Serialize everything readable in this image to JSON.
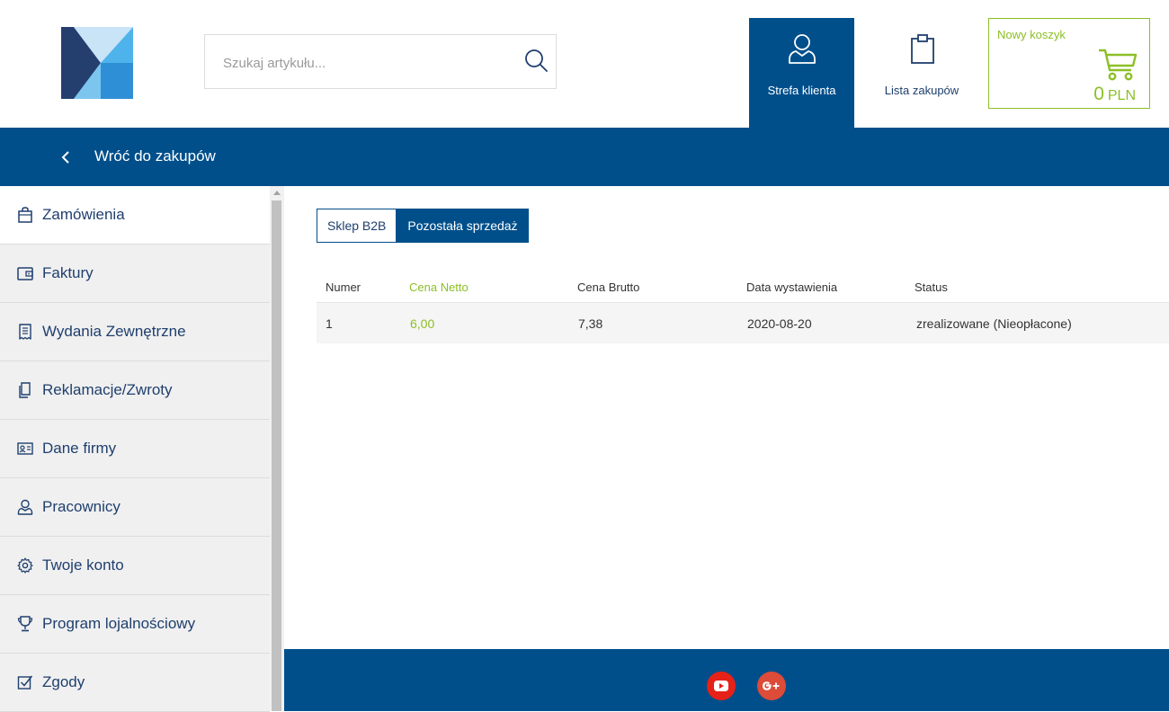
{
  "header": {
    "search": {
      "placeholder": "Szukaj artykułu..."
    },
    "nav": {
      "account_label": "Strefa klienta",
      "shopping_list_label": "Lista zakupów"
    },
    "cart": {
      "title": "Nowy koszyk",
      "amount": "0",
      "currency": "PLN"
    }
  },
  "bar": {
    "back_label": "Wróć do zakupów"
  },
  "sidebar": {
    "items": [
      {
        "label": "Zamówienia",
        "icon": "bag-icon"
      },
      {
        "label": "Faktury",
        "icon": "wallet-icon"
      },
      {
        "label": "Wydania Zewnętrzne",
        "icon": "receipt-icon"
      },
      {
        "label": "Reklamacje/Zwroty",
        "icon": "documents-icon"
      },
      {
        "label": "Dane firmy",
        "icon": "id-card-icon"
      },
      {
        "label": "Pracownicy",
        "icon": "user-icon"
      },
      {
        "label": "Twoje konto",
        "icon": "gear-icon"
      },
      {
        "label": "Program lojalnościowy",
        "icon": "trophy-icon"
      },
      {
        "label": "Zgody",
        "icon": "checkbox-icon"
      }
    ]
  },
  "main": {
    "tabs": [
      {
        "label": "Sklep B2B"
      },
      {
        "label": "Pozostała sprzedaż"
      }
    ],
    "table": {
      "headers": [
        "Numer",
        "Cena Netto",
        "Cena Brutto",
        "Data wystawienia",
        "Status"
      ],
      "rows": [
        [
          "1",
          "6,00",
          "7,38",
          "2020-08-20",
          "zrealizowane (Nieopłacone)"
        ]
      ]
    }
  },
  "colors": {
    "primary": "#004f8b",
    "accent_green": "#8cbf26",
    "sidebar_bg": "#f0f0f0"
  }
}
